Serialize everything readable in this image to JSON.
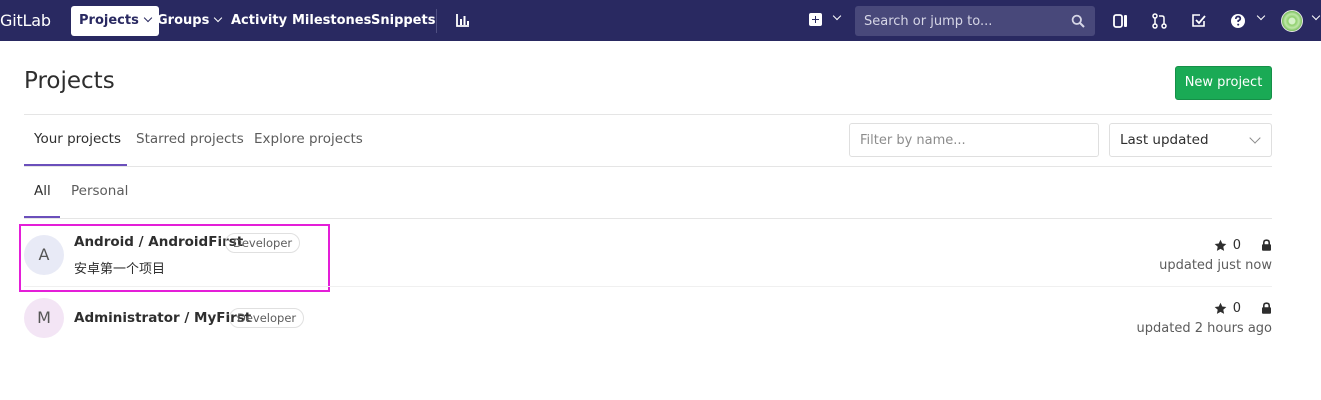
{
  "navbar": {
    "logo": "GitLab",
    "projects_label": "Projects",
    "groups_label": "Groups",
    "activity_label": "Activity",
    "milestones_label": "Milestones",
    "snippets_label": "Snippets",
    "search_placeholder": "Search or jump to...",
    "icons": [
      "chart-icon",
      "plus-icon",
      "search-icon",
      "sidebar-panel-icon",
      "merge-request-icon",
      "todo-check-icon",
      "help-icon",
      "user-avatar"
    ]
  },
  "header": {
    "title": "Projects",
    "new_project_label": "New project"
  },
  "tabs": [
    {
      "label": "Your projects",
      "active": true
    },
    {
      "label": "Starred projects",
      "active": false
    },
    {
      "label": "Explore projects",
      "active": false
    }
  ],
  "filter": {
    "placeholder": "Filter by name...",
    "sort_selected": "Last updated"
  },
  "subtabs": [
    {
      "label": "All",
      "active": true
    },
    {
      "label": "Personal",
      "active": false
    }
  ],
  "projects": [
    {
      "avatar_letter": "A",
      "name": "Android / AndroidFirst",
      "role": "Developer",
      "description": "安卓第一个项目",
      "stars": "0",
      "updated": "updated just now",
      "highlighted": true
    },
    {
      "avatar_letter": "M",
      "name": "Administrator / MyFirst",
      "role": "Developer",
      "description": "",
      "stars": "0",
      "updated": "updated 2 hours ago",
      "highlighted": false
    }
  ],
  "colors": {
    "navbar_bg": "#292961",
    "accent": "#6b4fbb",
    "new_project_bg": "#1aaa55",
    "highlight_border": "#e41ed8"
  }
}
